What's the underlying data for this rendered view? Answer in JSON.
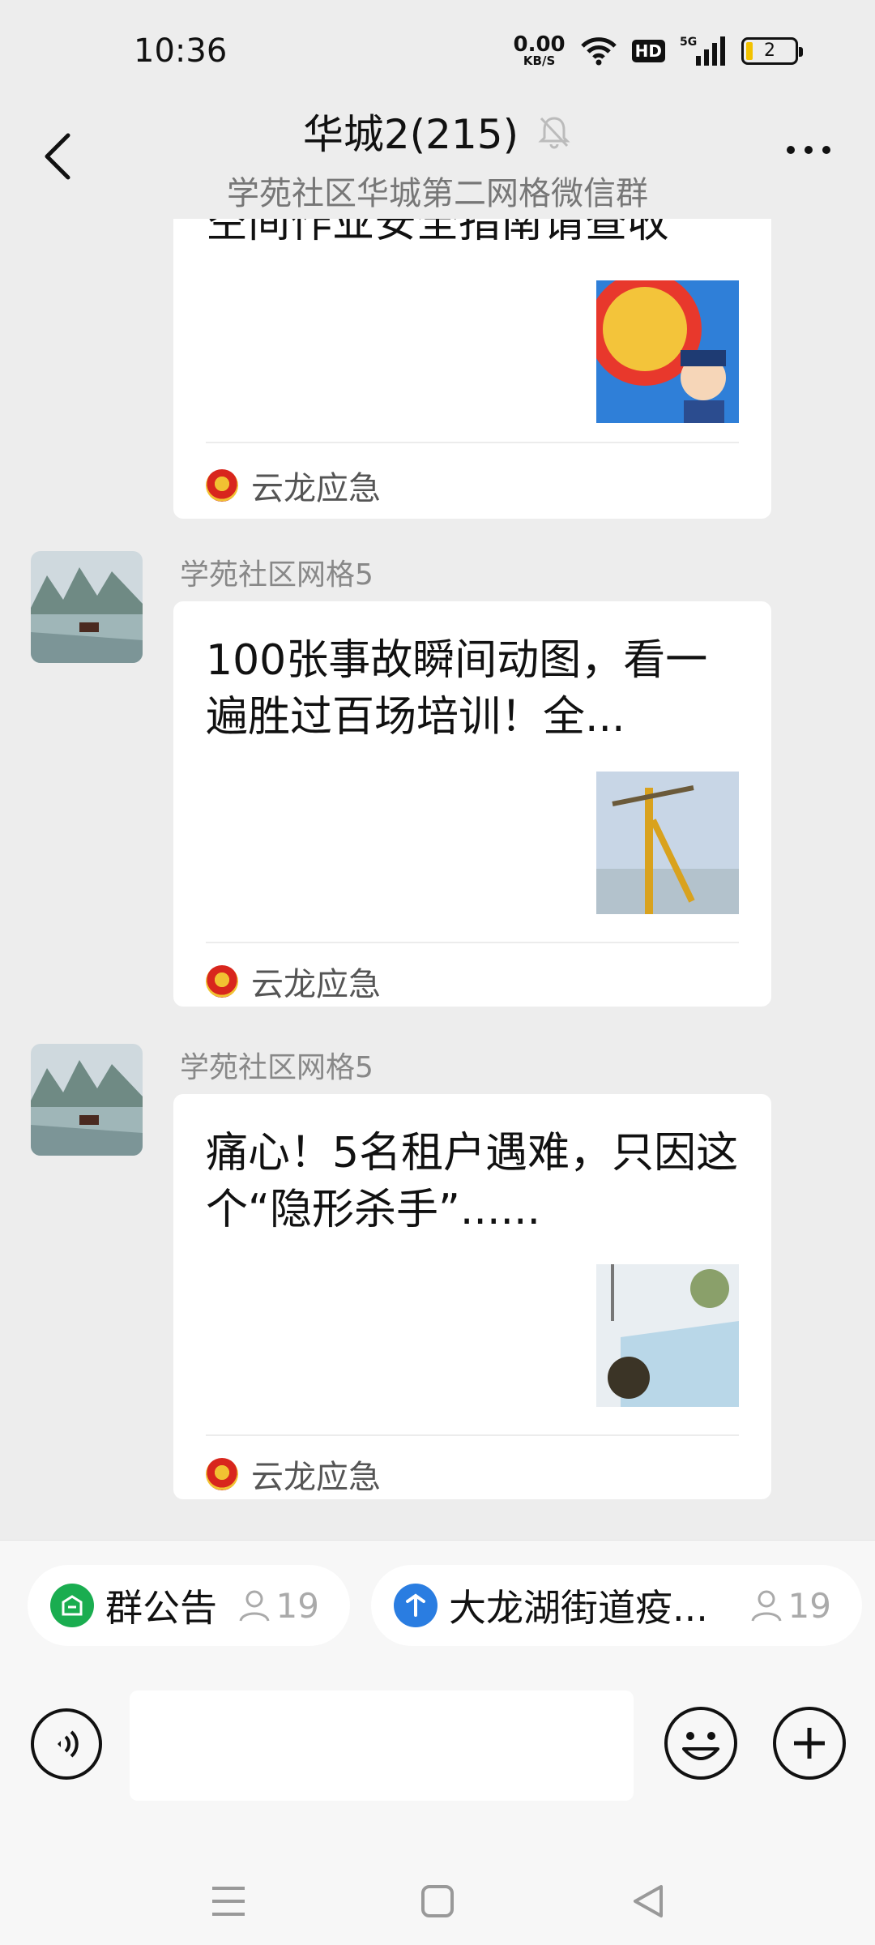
{
  "status_bar": {
    "time": "10:36",
    "speed_value": "0.00",
    "speed_unit": "KB/S",
    "hd": "HD",
    "network": "5G",
    "battery": "2"
  },
  "header": {
    "title": "华城2(215)",
    "subtitle": "学苑社区华城第二网格微信群"
  },
  "messages": [
    {
      "title": "空间作业安全指南请查收",
      "source": "云龙应急",
      "thumb": "cartoon-police-thumbnail"
    },
    {
      "sender": "学苑社区网格5",
      "title": "100张事故瞬间动图，看一遍胜过百场培训！全...",
      "source": "云龙应急",
      "thumb": "tower-crane-thumbnail"
    },
    {
      "sender": "学苑社区网格5",
      "title": "痛心！5名租户遇难，只因这个“隐形杀手”......",
      "source": "云龙应急",
      "thumb": "bathroom-illustration-thumbnail"
    }
  ],
  "chips": [
    {
      "label": "群公告",
      "count": "19",
      "icon": "announcement-icon",
      "color": "#1aad50"
    },
    {
      "label": "大龙湖街道疫...",
      "count": "19",
      "icon": "app-icon",
      "color": "#2a7de1"
    }
  ],
  "input": {
    "value": ""
  },
  "colors": {
    "background": "#ededed",
    "card": "#ffffff",
    "muted_text": "#888888"
  }
}
